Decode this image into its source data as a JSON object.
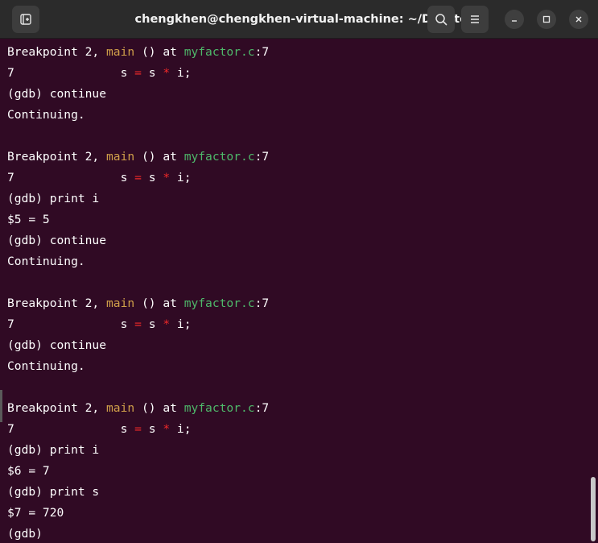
{
  "window": {
    "title": "chengkhen@chengkhen-virtual-machine: ~/Desktop"
  },
  "colors": {
    "terminal_bg": "#300a24",
    "titlebar_bg": "#2b2b2b",
    "function_name": "#d0a04a",
    "file_name": "#4eb86a",
    "operator": "#ef2929",
    "text": "#ffffff"
  },
  "icons": {
    "new_tab": "new-tab-icon",
    "search": "search-icon",
    "menu": "hamburger-menu-icon",
    "minimize": "minimize-icon",
    "maximize": "maximize-icon",
    "close": "close-icon"
  },
  "terminal": {
    "bp1": {
      "prefix": "Breakpoint 2, ",
      "fn": "main",
      "mid": " () at ",
      "file": "myfactor.c",
      "suffix": ":7"
    },
    "src1": {
      "lineno": "7",
      "a": "               s ",
      "eq": "=",
      "b": " s ",
      "mul": "*",
      "c": " i;"
    },
    "l3": "(gdb) continue",
    "l4": "Continuing.",
    "bp2": {
      "prefix": "Breakpoint 2, ",
      "fn": "main",
      "mid": " () at ",
      "file": "myfactor.c",
      "suffix": ":7"
    },
    "src2": {
      "lineno": "7",
      "a": "               s ",
      "eq": "=",
      "b": " s ",
      "mul": "*",
      "c": " i;"
    },
    "l8": "(gdb) print i",
    "l9": "$5 = 5",
    "l10": "(gdb) continue",
    "l11": "Continuing.",
    "bp3": {
      "prefix": "Breakpoint 2, ",
      "fn": "main",
      "mid": " () at ",
      "file": "myfactor.c",
      "suffix": ":7"
    },
    "src3": {
      "lineno": "7",
      "a": "               s ",
      "eq": "=",
      "b": " s ",
      "mul": "*",
      "c": " i;"
    },
    "l15": "(gdb) continue",
    "l16": "Continuing.",
    "bp4": {
      "prefix": "Breakpoint 2, ",
      "fn": "main",
      "mid": " () at ",
      "file": "myfactor.c",
      "suffix": ":7"
    },
    "src4": {
      "lineno": "7",
      "a": "               s ",
      "eq": "=",
      "b": " s ",
      "mul": "*",
      "c": " i;"
    },
    "l20": "(gdb) print i",
    "l21": "$6 = 7",
    "l22": "(gdb) print s",
    "l23": "$7 = 720",
    "l24": "(gdb)"
  }
}
